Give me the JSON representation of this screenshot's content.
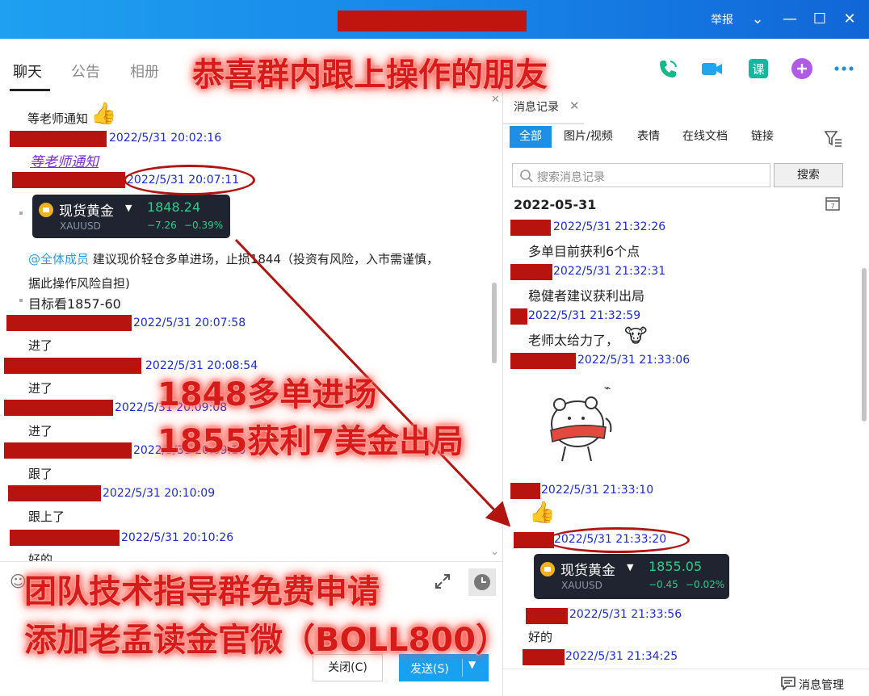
{
  "titlebar": {
    "report": "举报"
  },
  "header": {
    "tabs": [
      "聊天",
      "公告",
      "相册"
    ]
  },
  "overlay": {
    "top": "恭喜群内跟上操作的朋友",
    "mid1": "1848多单进场",
    "mid2": "1855获利7美金出局",
    "bottom1": "团队技术指导群免费申请",
    "bottom2": "添加老孟读金官微（BOLL800）"
  },
  "chat": {
    "msg_wait": "等老师通知",
    "ts1": "2022/5/31 20:02:16",
    "link_wait": "等老师通知",
    "ts2": "2022/5/31 20:07:11",
    "gold1": {
      "name": "现货黄金",
      "sym": "XAUUSD",
      "price": "1848.24",
      "chg": "−7.26",
      "pct": "−0.39%"
    },
    "mention": "@全体成员",
    "advice_line1": " 建议现价轻仓多单进场，止损1844（投资有风险，入市需谨慎，",
    "advice_line2": "据此操作风险自担)",
    "target": "目标看1857-60",
    "ts3": "2022/5/31 20:07:58",
    "jin1": "进了",
    "ts4": "2022/5/31 20:08:54",
    "jin2": "进了",
    "ts5": "2022/5/31 20:09:08",
    "jin3": "进了",
    "ts6": "2022/5/31 20:09:10",
    "gen1": "跟了",
    "ts7": "2022/5/31 20:10:09",
    "gen2": "跟上了",
    "ts8": "2022/5/31 20:10:26",
    "hao": "好的"
  },
  "buttons": {
    "close": "关闭(C)",
    "send": "发送(S)"
  },
  "history": {
    "title": "消息记录",
    "filters": [
      "全部",
      "图片/视频",
      "表情",
      "在线文档",
      "链接"
    ],
    "search_placeholder": "搜索消息记录",
    "search_btn": "搜索",
    "date": "2022-05-31",
    "ts1": "2022/5/31 21:32:26",
    "m1": "多单目前获利6个点",
    "ts2": "2022/5/31 21:32:31",
    "m2": "稳健者建议获利出局",
    "ts3": "2022/5/31 21:32:59",
    "m3": "老师太给力了，",
    "ts4": "2022/5/31 21:33:06",
    "ts5": "2022/5/31 21:33:10",
    "ts6": "2022/5/31 21:33:20",
    "gold2": {
      "name": "现货黄金",
      "sym": "XAUUSD",
      "price": "1855.05",
      "chg": "−0.45",
      "pct": "−0.02%"
    },
    "ts7": "2022/5/31 21:33:56",
    "m4": "好的",
    "ts8": "2022/5/31 21:34:25",
    "manage": "消息管理"
  }
}
